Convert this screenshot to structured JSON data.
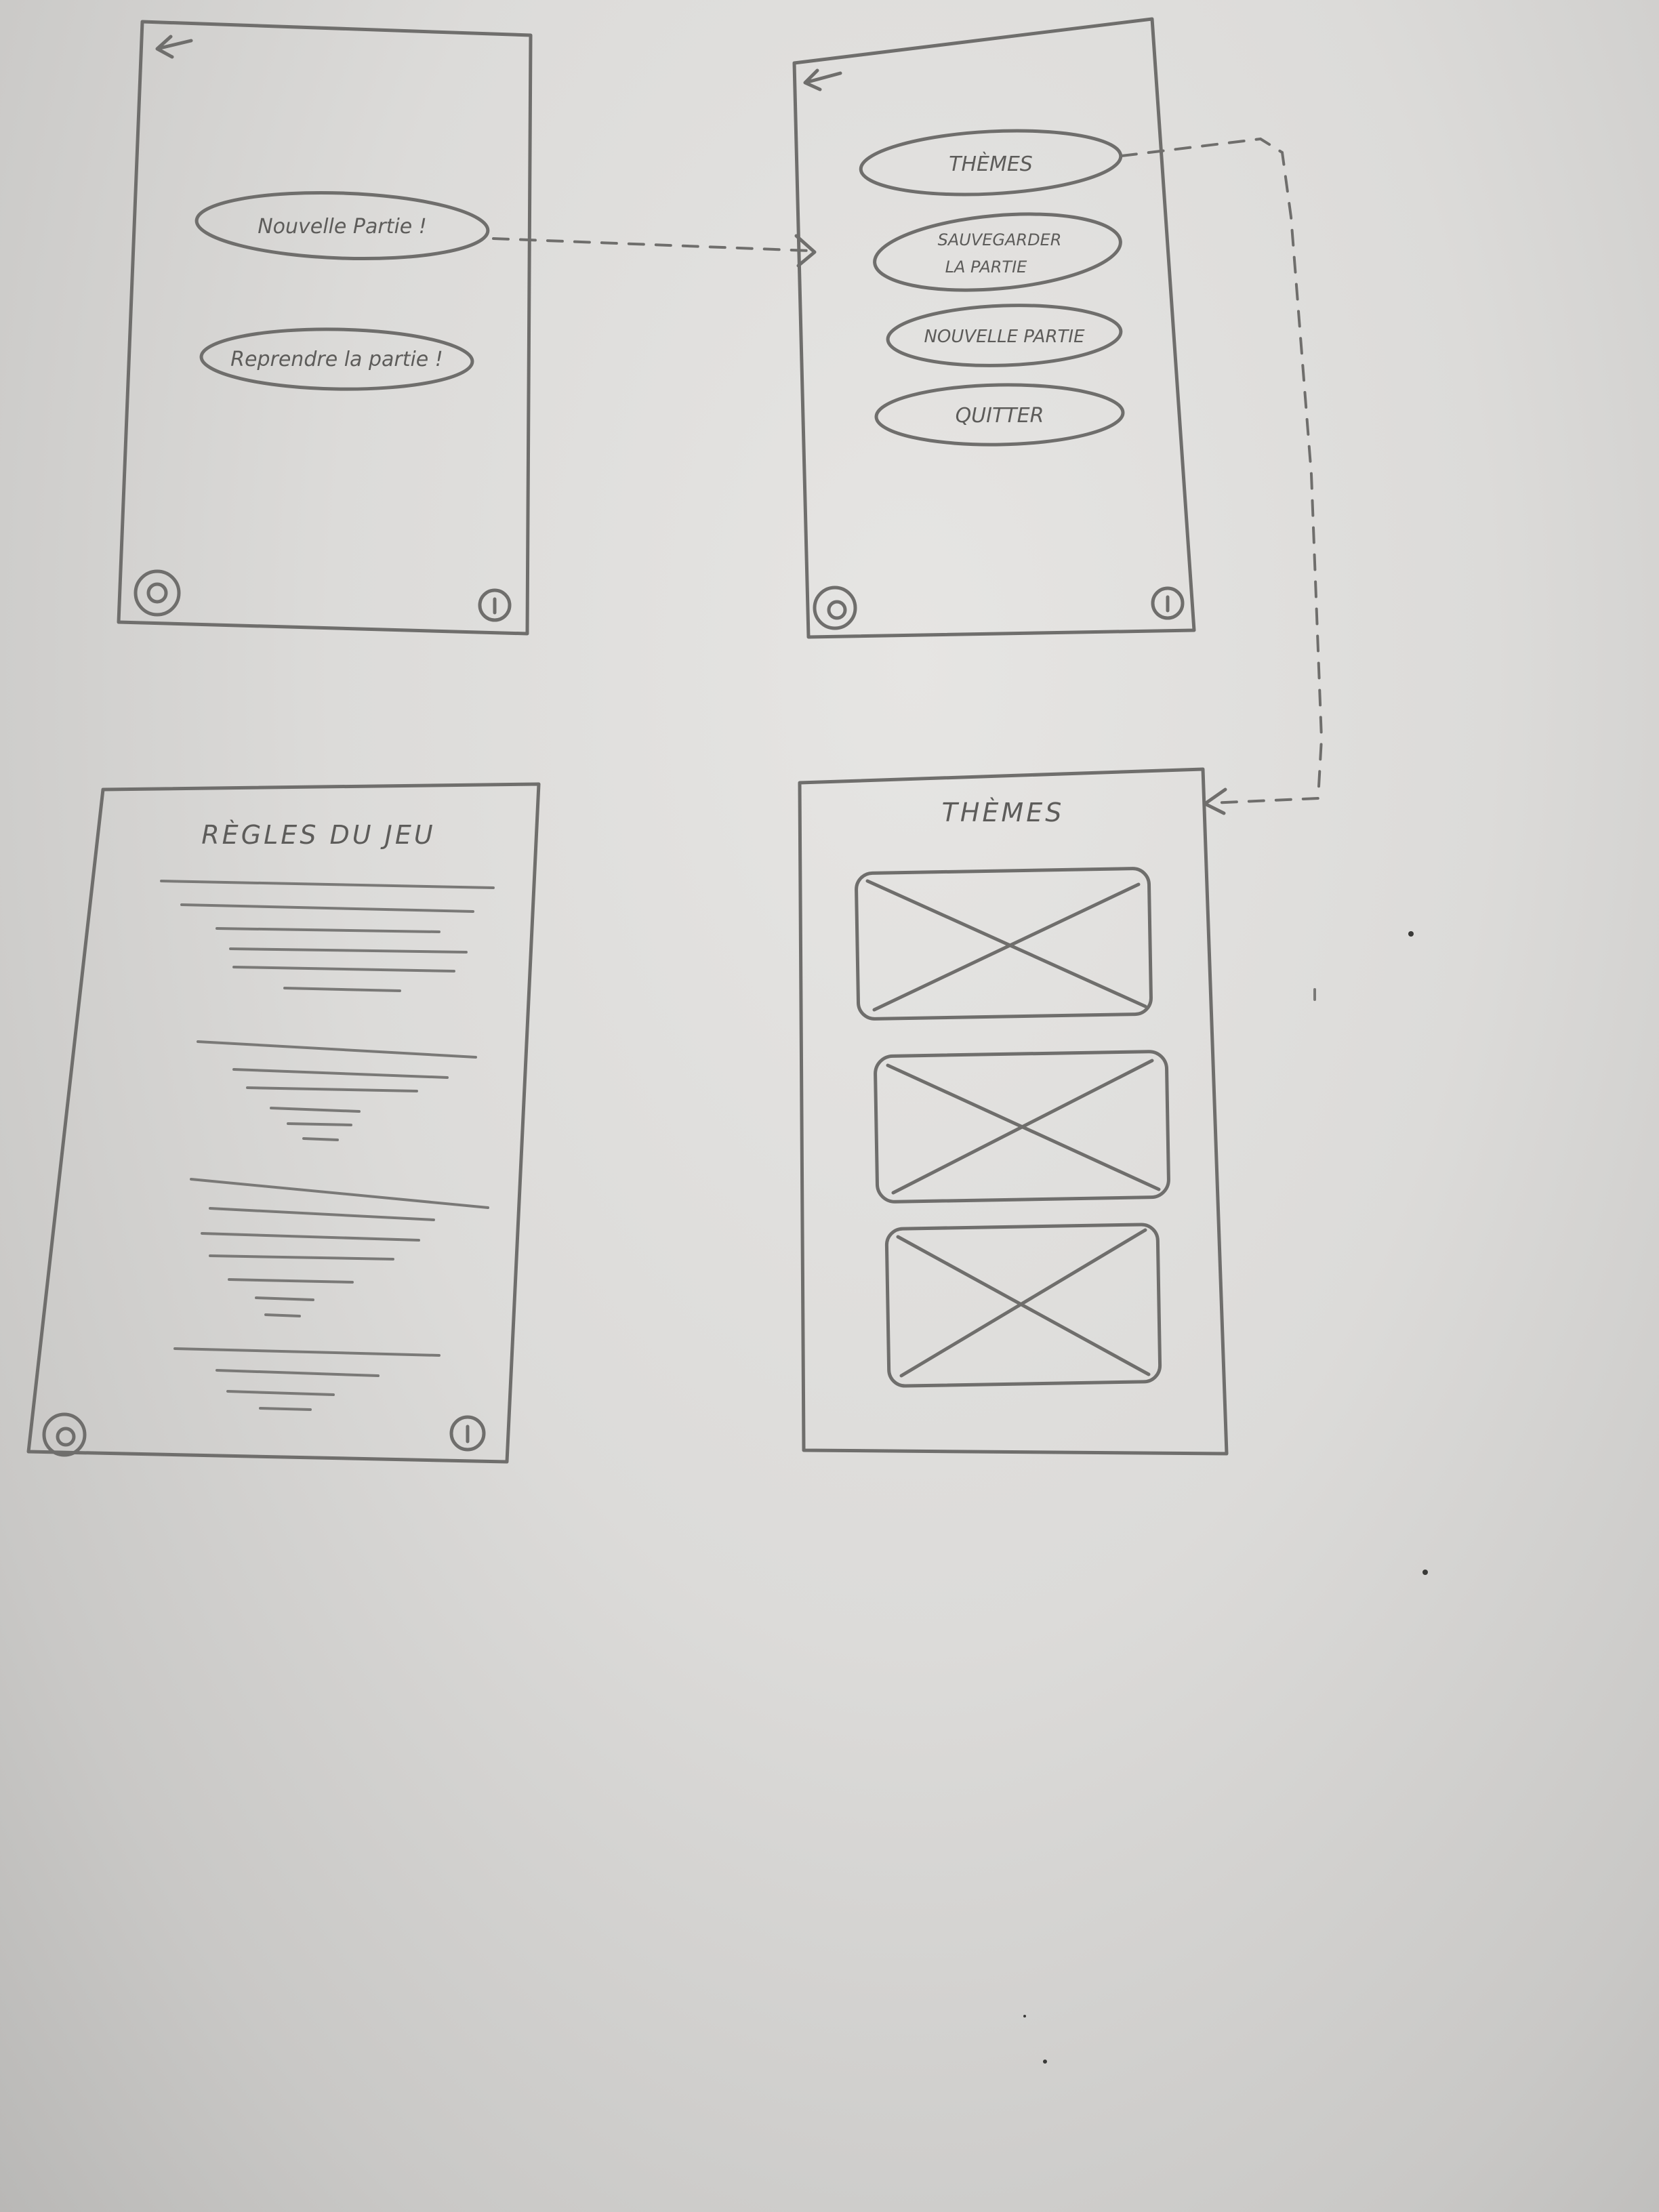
{
  "screens": {
    "home": {
      "new_game_label": "Nouvelle Partie !",
      "resume_label": "Reprendre la partie !"
    },
    "menu": {
      "themes_label": "THÈMES",
      "save_label_line1": "SAUVEGARDER",
      "save_label_line2": "LA PARTIE",
      "new_game_label": "NOUVELLE PARTIE",
      "quit_label": "QUITTER"
    },
    "rules": {
      "title": "RÈGLES DU JEU"
    },
    "themes": {
      "title": "THÈMES"
    }
  },
  "icons": {
    "back": "back-arrow-icon",
    "settings": "gear-icon",
    "info": "info-icon",
    "image_placeholder": "image-placeholder-icon"
  },
  "colors": {
    "paper": "#dcdbd9",
    "pencil": "#6f6e6c"
  }
}
